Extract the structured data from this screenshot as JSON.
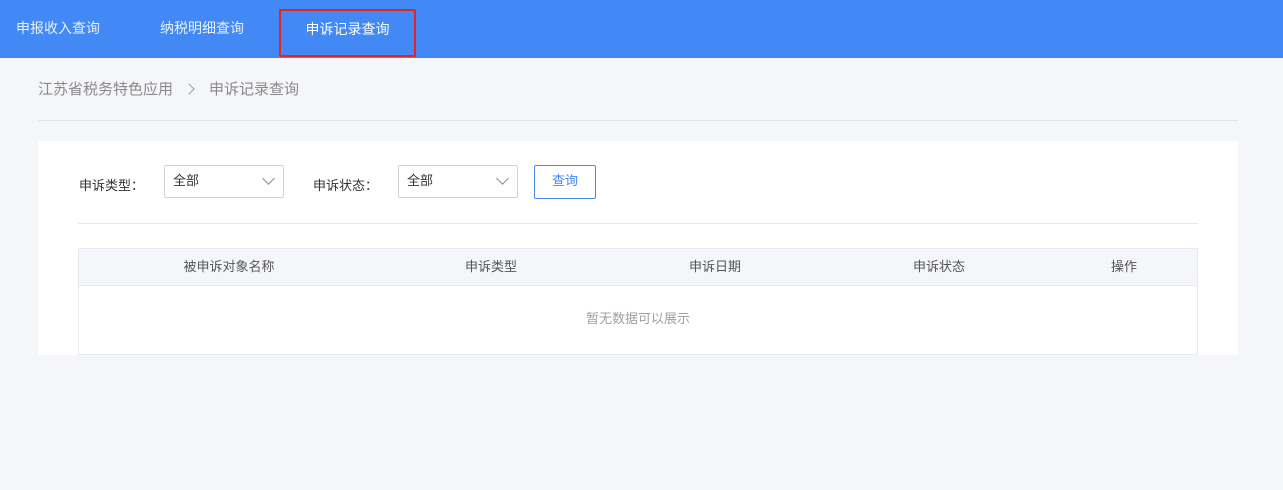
{
  "topnav": {
    "tabs": [
      {
        "label": "申报收入查询"
      },
      {
        "label": "纳税明细查询"
      },
      {
        "label": "申诉记录查询"
      }
    ],
    "accent": "#4289f6",
    "active_highlight": "#e62323"
  },
  "breadcrumb": {
    "root": "江苏省税务特色应用",
    "current": "申诉记录查询"
  },
  "filters": {
    "type_label": "申诉类型：",
    "type_value": "全部",
    "status_label": "申诉状态：",
    "status_value": "全部",
    "query_label": "查询"
  },
  "table": {
    "columns": [
      "被申诉对象名称",
      "申诉类型",
      "申诉日期",
      "申诉状态",
      "操作"
    ],
    "empty_text": "暂无数据可以展示"
  }
}
